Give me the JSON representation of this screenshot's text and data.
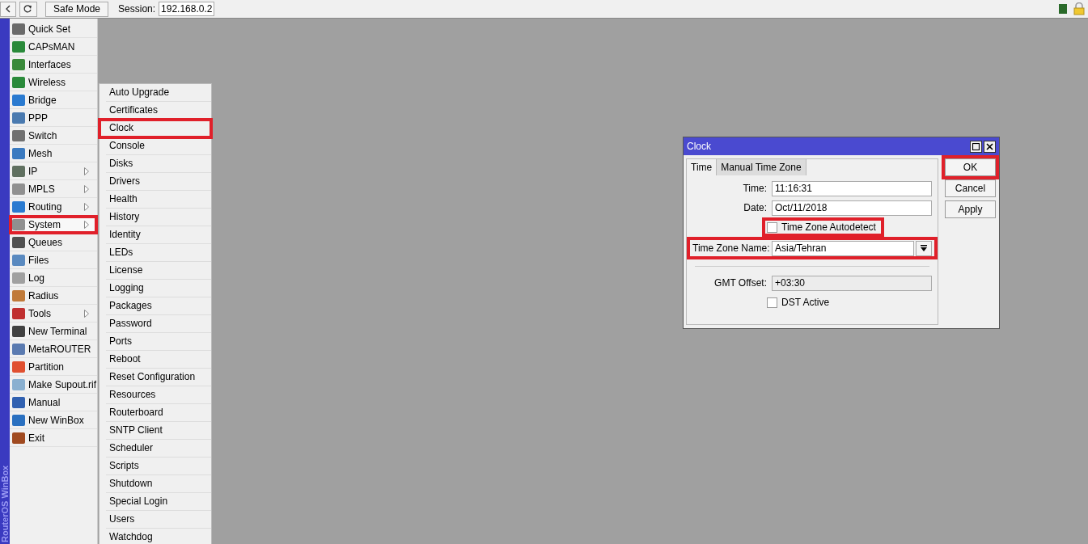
{
  "toolbar": {
    "safe_mode_button": "Safe Mode",
    "session_label": "Session:",
    "session_value": "192.168.0.2"
  },
  "side_label": "RouterOS WinBox",
  "menu": [
    {
      "label": "Quick Set",
      "submenu": false,
      "highlighted": false
    },
    {
      "label": "CAPsMAN",
      "submenu": false,
      "highlighted": false
    },
    {
      "label": "Interfaces",
      "submenu": false,
      "highlighted": false
    },
    {
      "label": "Wireless",
      "submenu": false,
      "highlighted": false
    },
    {
      "label": "Bridge",
      "submenu": false,
      "highlighted": false
    },
    {
      "label": "PPP",
      "submenu": false,
      "highlighted": false
    },
    {
      "label": "Switch",
      "submenu": false,
      "highlighted": false
    },
    {
      "label": "Mesh",
      "submenu": false,
      "highlighted": false
    },
    {
      "label": "IP",
      "submenu": true,
      "highlighted": false
    },
    {
      "label": "MPLS",
      "submenu": true,
      "highlighted": false
    },
    {
      "label": "Routing",
      "submenu": true,
      "highlighted": false
    },
    {
      "label": "System",
      "submenu": true,
      "highlighted": true
    },
    {
      "label": "Queues",
      "submenu": false,
      "highlighted": false
    },
    {
      "label": "Files",
      "submenu": false,
      "highlighted": false
    },
    {
      "label": "Log",
      "submenu": false,
      "highlighted": false
    },
    {
      "label": "Radius",
      "submenu": false,
      "highlighted": false
    },
    {
      "label": "Tools",
      "submenu": true,
      "highlighted": false
    },
    {
      "label": "New Terminal",
      "submenu": false,
      "highlighted": false
    },
    {
      "label": "MetaROUTER",
      "submenu": false,
      "highlighted": false
    },
    {
      "label": "Partition",
      "submenu": false,
      "highlighted": false
    },
    {
      "label": "Make Supout.rif",
      "submenu": false,
      "highlighted": false
    },
    {
      "label": "Manual",
      "submenu": false,
      "highlighted": false
    },
    {
      "label": "New WinBox",
      "submenu": false,
      "highlighted": false
    },
    {
      "label": "Exit",
      "submenu": false,
      "highlighted": false
    }
  ],
  "submenu": [
    {
      "label": "Auto Upgrade",
      "highlighted": false
    },
    {
      "label": "Certificates",
      "highlighted": false
    },
    {
      "label": "Clock",
      "highlighted": true
    },
    {
      "label": "Console",
      "highlighted": false
    },
    {
      "label": "Disks",
      "highlighted": false
    },
    {
      "label": "Drivers",
      "highlighted": false
    },
    {
      "label": "Health",
      "highlighted": false
    },
    {
      "label": "History",
      "highlighted": false
    },
    {
      "label": "Identity",
      "highlighted": false
    },
    {
      "label": "LEDs",
      "highlighted": false
    },
    {
      "label": "License",
      "highlighted": false
    },
    {
      "label": "Logging",
      "highlighted": false
    },
    {
      "label": "Packages",
      "highlighted": false
    },
    {
      "label": "Password",
      "highlighted": false
    },
    {
      "label": "Ports",
      "highlighted": false
    },
    {
      "label": "Reboot",
      "highlighted": false
    },
    {
      "label": "Reset Configuration",
      "highlighted": false
    },
    {
      "label": "Resources",
      "highlighted": false
    },
    {
      "label": "Routerboard",
      "highlighted": false
    },
    {
      "label": "SNTP Client",
      "highlighted": false
    },
    {
      "label": "Scheduler",
      "highlighted": false
    },
    {
      "label": "Scripts",
      "highlighted": false
    },
    {
      "label": "Shutdown",
      "highlighted": false
    },
    {
      "label": "Special Login",
      "highlighted": false
    },
    {
      "label": "Users",
      "highlighted": false
    },
    {
      "label": "Watchdog",
      "highlighted": false
    }
  ],
  "dialog": {
    "title": "Clock",
    "tabs": [
      {
        "label": "Time",
        "selected": true
      },
      {
        "label": "Manual Time Zone",
        "selected": false
      }
    ],
    "rows": [
      {
        "kind": "field",
        "label": "Time:",
        "value": "11:16:31",
        "highlighted": false
      },
      {
        "kind": "field",
        "label": "Date:",
        "value": "Oct/11/2018",
        "highlighted": false
      },
      {
        "kind": "checkbox",
        "label": "Time Zone Autodetect",
        "checked": false,
        "highlighted": true
      },
      {
        "kind": "dropdown",
        "label": "Time Zone Name:",
        "value": "Asia/Tehran",
        "highlighted": true
      },
      {
        "kind": "separator"
      },
      {
        "kind": "readonly",
        "label": "GMT Offset:",
        "value": "+03:30",
        "highlighted": false
      },
      {
        "kind": "checkbox",
        "label": "DST Active",
        "checked": false,
        "highlighted": false
      }
    ],
    "buttons": [
      {
        "label": "OK",
        "highlighted": true
      },
      {
        "label": "Cancel",
        "highlighted": false
      },
      {
        "label": "Apply",
        "highlighted": false
      }
    ]
  }
}
